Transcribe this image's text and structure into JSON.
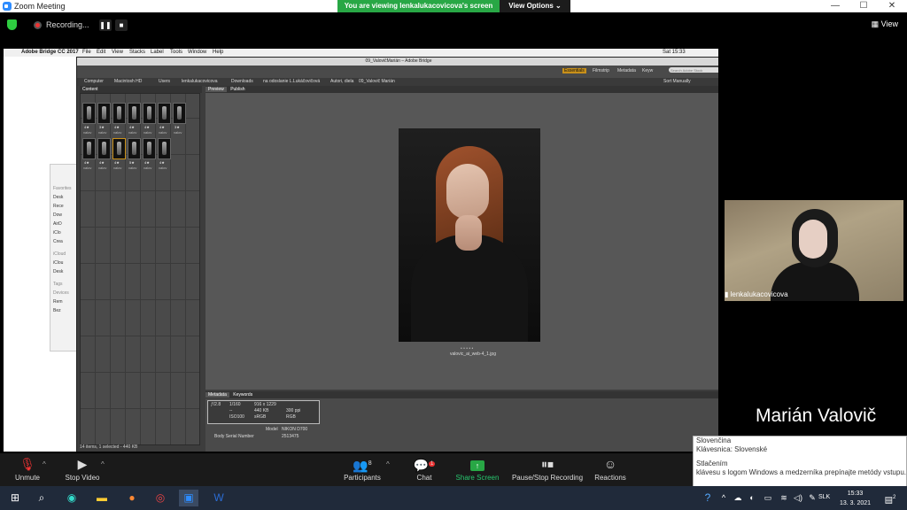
{
  "window": {
    "title": "Zoom Meeting",
    "minimize": "—",
    "maximize": "☐",
    "close": "✕"
  },
  "banner": {
    "text": "You are viewing lenkalukacovicova's screen",
    "options_label": "View Options ⌄"
  },
  "recording": {
    "label": "Recording...",
    "pause": "❚❚",
    "stop": "■",
    "view_label": "View"
  },
  "shared_screen": {
    "mac_menu": [
      "Adobe Bridge CC 2017",
      "File",
      "Edit",
      "View",
      "Stacks",
      "Label",
      "Tools",
      "Window",
      "Help"
    ],
    "mac_time": "Sat 15:33",
    "bridge_title": "09_ValovičMarián – Adobe Bridge",
    "workspaces": [
      "Essentials",
      "Filmstrip",
      "Metadata",
      "Keyw"
    ],
    "search_placeholder": "Search Adobe Stock",
    "sort": "Sort Manually",
    "path": [
      "Computer",
      "Macintosh HD",
      "Users",
      "lenkalukacovicova",
      "Downloads",
      "na odoslanie L.Lukáčovičová",
      "Autori, diela",
      "09_Valovič Marián"
    ],
    "content_tab": "Content",
    "thumb_rows": [
      {
        "stars": [
          "4★",
          "3★",
          "4★",
          "4★",
          "4★",
          "4★",
          "3★"
        ],
        "labels": [
          "valov",
          "valov",
          "valov",
          "valov",
          "valov",
          "valov",
          "valov"
        ]
      },
      {
        "stars": [
          "4★",
          "4★",
          "4★",
          "5★",
          "4★",
          "4★"
        ],
        "labels": [
          "valov",
          "valov",
          "valov",
          "valov",
          "valov",
          "valov"
        ]
      }
    ],
    "content_status": "14 items, 1 selected - 440 KB",
    "preview_tabs": [
      "Preview",
      "Publish"
    ],
    "preview_stars": "• • • • •",
    "preview_filename": "valovic_ai_web-4_1.jpg",
    "meta_tabs": [
      "Metadata",
      "Keywords"
    ],
    "meta": {
      "aperture": "ƒ/2.8",
      "shutter": "1/160",
      "dims": "916 x 1229",
      "size": "440 KB",
      "ppi": "300 ppi",
      "ev": "--",
      "iso": "ISO100",
      "color": "sRGB",
      "mode": "RGB",
      "model_label": "Model",
      "model": "NIKON D700",
      "serial_label": "Body Serial Number",
      "serial": "2513475"
    },
    "finder": {
      "fav": "Favorites",
      "items": [
        "Desk",
        "Rece",
        "Dow",
        "AirD",
        "iClo",
        "Crea"
      ],
      "icloud": "iCloud",
      "icloud_items": [
        "iClou",
        "Desk"
      ],
      "tags": "Tags",
      "devices": "Devices",
      "dev_items": [
        "Rem",
        "Bez"
      ]
    }
  },
  "webcam": {
    "name": "lenkalukacovicova"
  },
  "presenter_name": "Marián Valovič",
  "ime_popup": {
    "line1": "Slovenčina",
    "line2": "Klávesnica: Slovenské",
    "line3": "Stlačením",
    "line4": "klávesu s logom Windows a medzerníka prepínajte metódy vstupu."
  },
  "toolbar": {
    "unmute": "Unmute",
    "stop_video": "Stop Video",
    "participants": "Participants",
    "participants_count": "8",
    "chat": "Chat",
    "chat_badge": "1",
    "share": "Share Screen",
    "pause_stop": "Pause/Stop Recording",
    "reactions": "Reactions"
  },
  "taskbar": {
    "lang": "SLK",
    "time": "15:33",
    "date": "13. 3. 2021",
    "notif": "2"
  },
  "colors": {
    "share_green": "#28a745",
    "banner_green": "#28a745",
    "taskbar": "#202a3a",
    "toolbar": "#1a1a1a"
  }
}
